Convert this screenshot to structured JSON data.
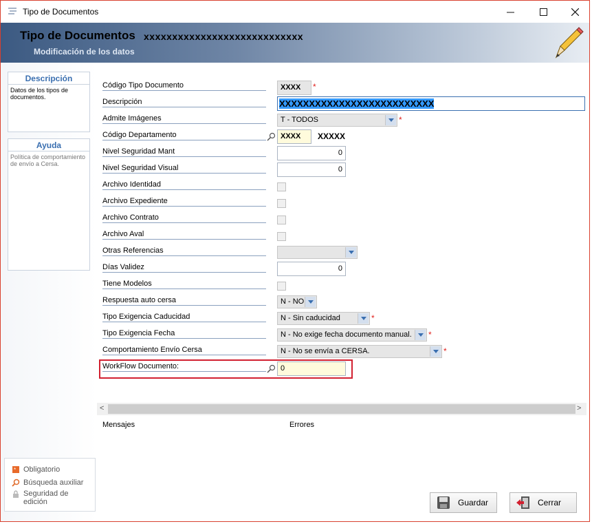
{
  "window": {
    "title": "Tipo de Documentos",
    "controls": {
      "minimize": "—",
      "maximize": "☐",
      "close": "✕"
    }
  },
  "header": {
    "title": "Tipo de Documentos",
    "code": "xxxxxxxxxxxxxxxxxxxxxxxxxxxx",
    "subtitle": "Modificación de los datos"
  },
  "sidebar": {
    "description": {
      "title": "Descripción",
      "text": "Datos de los tipos de documentos."
    },
    "help": {
      "title": "Ayuda",
      "text": "Política de comportamiento de envío a Cersa."
    },
    "legend": {
      "required": "Obligatorio",
      "aux_search": "Búsqueda auxiliar",
      "edit_security": "Seguridad de edición"
    }
  },
  "form": {
    "codigo_tipo": {
      "label": "Código Tipo Documento",
      "value": "XXXX"
    },
    "descripcion": {
      "label": "Descripción",
      "value": "XXXXXXXXXXXXXXXXXXXXXXXXXX"
    },
    "admite_imagenes": {
      "label": "Admite Imágenes",
      "value": "T - TODOS"
    },
    "codigo_departamento": {
      "label": "Código Departamento",
      "value": "XXXX",
      "name": "XXXXX"
    },
    "nivel_seg_mant": {
      "label": "Nivel Seguridad Mant",
      "value": "0"
    },
    "nivel_seg_visual": {
      "label": "Nivel Seguridad Visual",
      "value": "0"
    },
    "archivo_identidad": {
      "label": "Archivo Identidad"
    },
    "archivo_expediente": {
      "label": "Archivo Expediente"
    },
    "archivo_contrato": {
      "label": "Archivo Contrato"
    },
    "archivo_aval": {
      "label": "Archivo Aval"
    },
    "otras_referencias": {
      "label": "Otras Referencias",
      "value": ""
    },
    "dias_validez": {
      "label": "Días Validez",
      "value": "0"
    },
    "tiene_modelos": {
      "label": "Tiene Modelos"
    },
    "respuesta_auto": {
      "label": "Respuesta auto cersa",
      "value": "N - NO"
    },
    "tipo_exig_caducidad": {
      "label": "Tipo Exigencia Caducidad",
      "value": "N - Sin caducidad"
    },
    "tipo_exig_fecha": {
      "label": "Tipo Exigencia Fecha",
      "value": "N - No exige fecha documento manual."
    },
    "comportamiento_envio": {
      "label": "Comportamiento Envío Cersa",
      "value": "N - No se envía a CERSA."
    },
    "workflow_documento": {
      "label": "WorkFlow Documento:",
      "value": "0"
    }
  },
  "messages": {
    "mensajes": "Mensajes",
    "errores": "Errores"
  },
  "buttons": {
    "guardar": "Guardar",
    "cerrar": "Cerrar"
  },
  "colors": {
    "required": "#e0201c",
    "highlight": "#d22030",
    "accent": "#3a6fb0"
  }
}
